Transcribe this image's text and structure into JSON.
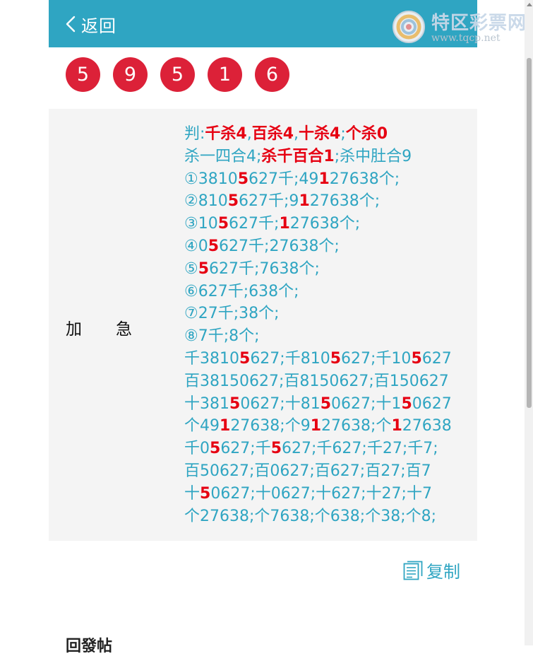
{
  "header": {
    "back_label": "返回"
  },
  "watermark": {
    "name": "特区彩票网",
    "url": "www.tqcp.net"
  },
  "balls": [
    "5",
    "9",
    "5",
    "1",
    "6"
  ],
  "panel": {
    "label_1": "加",
    "label_2": "急",
    "lines": [
      [
        {
          "t": "判:",
          "h": false
        },
        {
          "t": "千杀4",
          "h": true
        },
        {
          "t": ",",
          "h": false
        },
        {
          "t": "百杀4",
          "h": true
        },
        {
          "t": ",",
          "h": false
        },
        {
          "t": "十杀4",
          "h": true
        },
        {
          "t": ";",
          "h": false
        },
        {
          "t": "个杀0",
          "h": true
        }
      ],
      [
        {
          "t": "杀一四合4;",
          "h": false
        },
        {
          "t": "杀千百合1",
          "h": true
        },
        {
          "t": ";杀中肚合9",
          "h": false
        }
      ],
      [
        {
          "t": "①3810",
          "h": false
        },
        {
          "t": "5",
          "h": true
        },
        {
          "t": "627千;49",
          "h": false
        },
        {
          "t": "1",
          "h": true
        },
        {
          "t": "27638个;",
          "h": false
        }
      ],
      [
        {
          "t": "②810",
          "h": false
        },
        {
          "t": "5",
          "h": true
        },
        {
          "t": "627千;9",
          "h": false
        },
        {
          "t": "1",
          "h": true
        },
        {
          "t": "27638个;",
          "h": false
        }
      ],
      [
        {
          "t": "③10",
          "h": false
        },
        {
          "t": "5",
          "h": true
        },
        {
          "t": "627千;",
          "h": false
        },
        {
          "t": "1",
          "h": true
        },
        {
          "t": "27638个;",
          "h": false
        }
      ],
      [
        {
          "t": "④0",
          "h": false
        },
        {
          "t": "5",
          "h": true
        },
        {
          "t": "627千;27638个;",
          "h": false
        }
      ],
      [
        {
          "t": "⑤",
          "h": false
        },
        {
          "t": "5",
          "h": true
        },
        {
          "t": "627千;7638个;",
          "h": false
        }
      ],
      [
        {
          "t": "⑥627千;638个;",
          "h": false
        }
      ],
      [
        {
          "t": "⑦27千;38个;",
          "h": false
        }
      ],
      [
        {
          "t": "⑧7千;8个;",
          "h": false
        }
      ],
      [
        {
          "t": "千3810",
          "h": false
        },
        {
          "t": "5",
          "h": true
        },
        {
          "t": "627;千810",
          "h": false
        },
        {
          "t": "5",
          "h": true
        },
        {
          "t": "627;千10",
          "h": false
        },
        {
          "t": "5",
          "h": true
        },
        {
          "t": "627",
          "h": false
        }
      ],
      [
        {
          "t": "百38150627;百8150627;百150627",
          "h": false
        }
      ],
      [
        {
          "t": "十381",
          "h": false
        },
        {
          "t": "5",
          "h": true
        },
        {
          "t": "0627;十81",
          "h": false
        },
        {
          "t": "5",
          "h": true
        },
        {
          "t": "0627;十1",
          "h": false
        },
        {
          "t": "5",
          "h": true
        },
        {
          "t": "0627",
          "h": false
        }
      ],
      [
        {
          "t": "个49",
          "h": false
        },
        {
          "t": "1",
          "h": true
        },
        {
          "t": "27638;个9",
          "h": false
        },
        {
          "t": "1",
          "h": true
        },
        {
          "t": "27638;个",
          "h": false
        },
        {
          "t": "1",
          "h": true
        },
        {
          "t": "27638",
          "h": false
        }
      ],
      [
        {
          "t": "千0",
          "h": false
        },
        {
          "t": "5",
          "h": true
        },
        {
          "t": "627;千",
          "h": false
        },
        {
          "t": "5",
          "h": true
        },
        {
          "t": "627;千627;千27;千7;",
          "h": false
        }
      ],
      [
        {
          "t": "百50627;百0627;百627;百27;百7",
          "h": false
        }
      ],
      [
        {
          "t": "十",
          "h": false
        },
        {
          "t": "5",
          "h": true
        },
        {
          "t": "0627;十0627;十627;十27;十7",
          "h": false
        }
      ],
      [
        {
          "t": "个27638;个7638;个638;个38;个8;",
          "h": false
        }
      ]
    ]
  },
  "copy": {
    "label": "复制"
  },
  "bottom": {
    "text": "回發帖"
  },
  "colors": {
    "header_bg": "#2fa5c2",
    "ball_bg": "#dc2138",
    "text_teal": "#2fa5c2",
    "highlight_red": "#e60012",
    "panel_bg": "#f4f4f4"
  },
  "icons": {
    "back": "chevron-left-icon",
    "copy": "document-copy-icon",
    "watermark_logo": "lottery-logo-icon"
  }
}
